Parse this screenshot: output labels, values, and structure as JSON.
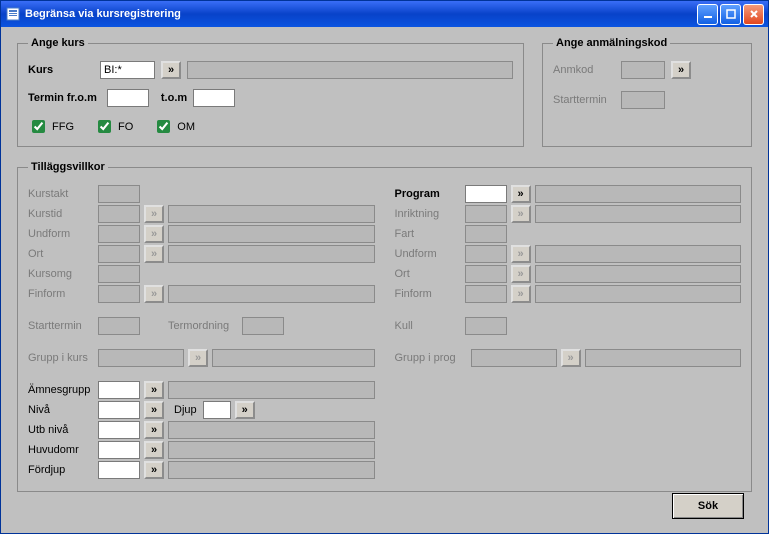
{
  "window": {
    "title": "Begränsa via kursregistrering"
  },
  "kurs": {
    "legend": "Ange kurs",
    "kurs_label": "Kurs",
    "kurs_value": "BI:*",
    "termin_from_label": "Termin fr.o.m",
    "termin_to_label": "t.o.m",
    "ffg_label": "FFG",
    "fo_label": "FO",
    "om_label": "OM",
    "picker_glyph": "»"
  },
  "anm": {
    "legend": "Ange anmälningskod",
    "anmkod_label": "Anmkod",
    "starttermin_label": "Starttermin",
    "picker_glyph": "»"
  },
  "till": {
    "legend": "Tilläggsvillkor",
    "left": {
      "kurstakt": "Kurstakt",
      "kurstid": "Kurstid",
      "undform": "Undform",
      "ort": "Ort",
      "kursomg": "Kursomg",
      "finform": "Finform",
      "starttermin": "Starttermin",
      "termordning": "Termordning",
      "grupp_kurs": "Grupp i kurs",
      "amnesgrupp": "Ämnesgrupp",
      "niva": "Nivå",
      "utb_niva": "Utb nivå",
      "huvudomr": "Huvudomr",
      "fordjup": "Fördjup",
      "djup": "Djup"
    },
    "right": {
      "program": "Program",
      "inriktning": "Inriktning",
      "fart": "Fart",
      "undform": "Undform",
      "ort": "Ort",
      "finform": "Finform",
      "kull": "Kull",
      "grupp_prog": "Grupp i prog"
    },
    "picker_glyph": "»"
  },
  "search_label": "Sök"
}
